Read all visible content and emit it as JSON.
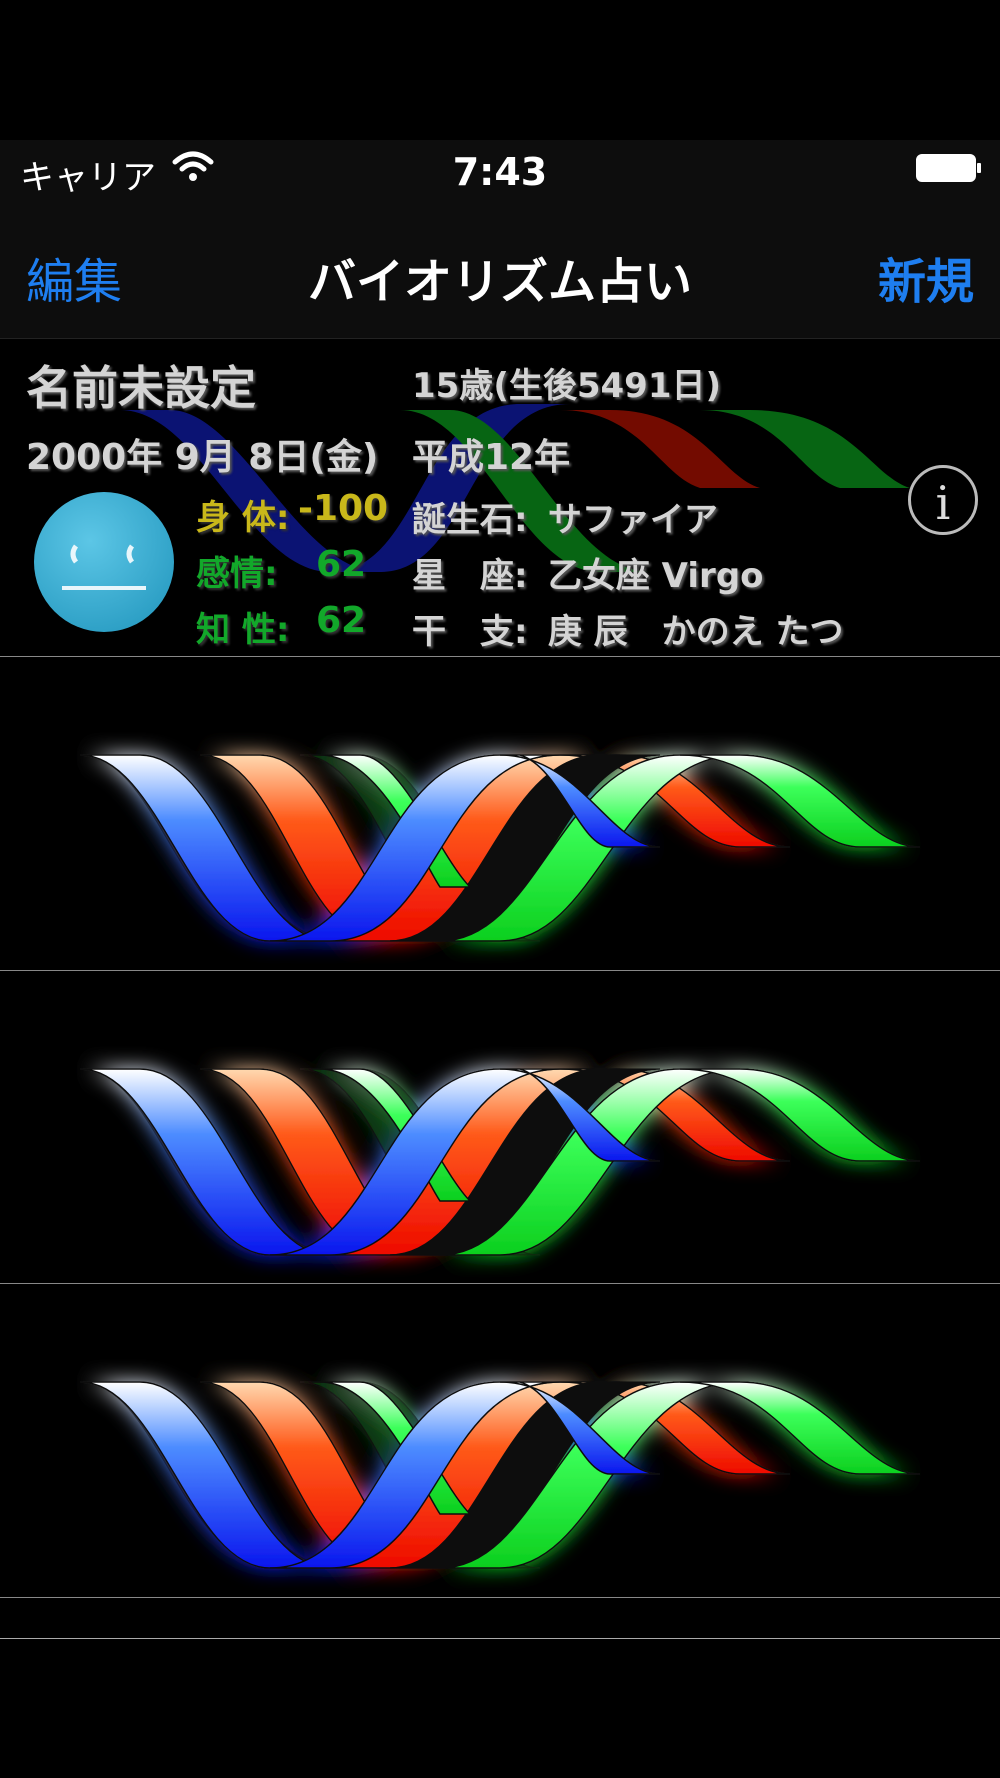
{
  "status_bar": {
    "carrier": "キャリア",
    "time": "7:43"
  },
  "nav": {
    "left": "編集",
    "title": "バイオリズム占い",
    "right": "新規"
  },
  "header": {
    "name": "名前未設定",
    "age": "15歳(生後5491日)",
    "birthdate": "2000年 9月 8日(金)",
    "era": "平成12年",
    "biorhythm": {
      "physical_label": "身 体:",
      "physical_value": "-100",
      "emotion_label": "感情:",
      "emotion_value": "62",
      "intellect_label": "知 性:",
      "intellect_value": "62"
    },
    "birthstone_label": "誕生石:",
    "birthstone_value": "サファイア",
    "zodiac_label": "星　座:",
    "zodiac_value": "乙女座 Virgo",
    "eto_label": "干　支:",
    "eto_value": "庚 辰　かのえ たつ",
    "info_icon": "i"
  },
  "rows": [
    {
      "name": "ribbon-row-1"
    },
    {
      "name": "ribbon-row-2"
    },
    {
      "name": "ribbon-row-3"
    }
  ],
  "icons": {
    "wifi": "wifi-icon",
    "battery": "battery-icon",
    "avatar": "smiley-face-icon",
    "info": "info-icon"
  },
  "colors": {
    "accent": "#1e7ef0",
    "physical": "#c9b81a",
    "emotion": "#12a82a",
    "ribbon_blue": "#1a2cff",
    "ribbon_red": "#ff1a00",
    "ribbon_green": "#11e02a"
  }
}
